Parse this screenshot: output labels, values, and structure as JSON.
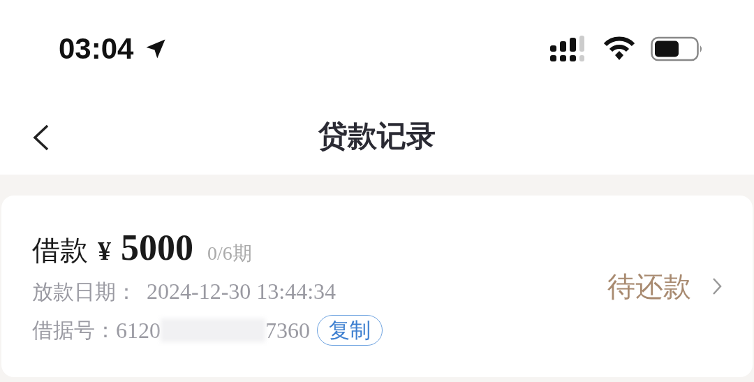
{
  "status_bar": {
    "time": "03:04"
  },
  "nav": {
    "title": "贷款记录"
  },
  "loan": {
    "label": "借款",
    "currency": "¥",
    "amount": "5000",
    "period": "0/6期",
    "date_label": "放款日期：",
    "date": "2024-12-30 13:44:34",
    "number_label": "借据号：",
    "number_start": "6120",
    "number_end": "7360",
    "copy": "复制",
    "status": "待还款"
  }
}
